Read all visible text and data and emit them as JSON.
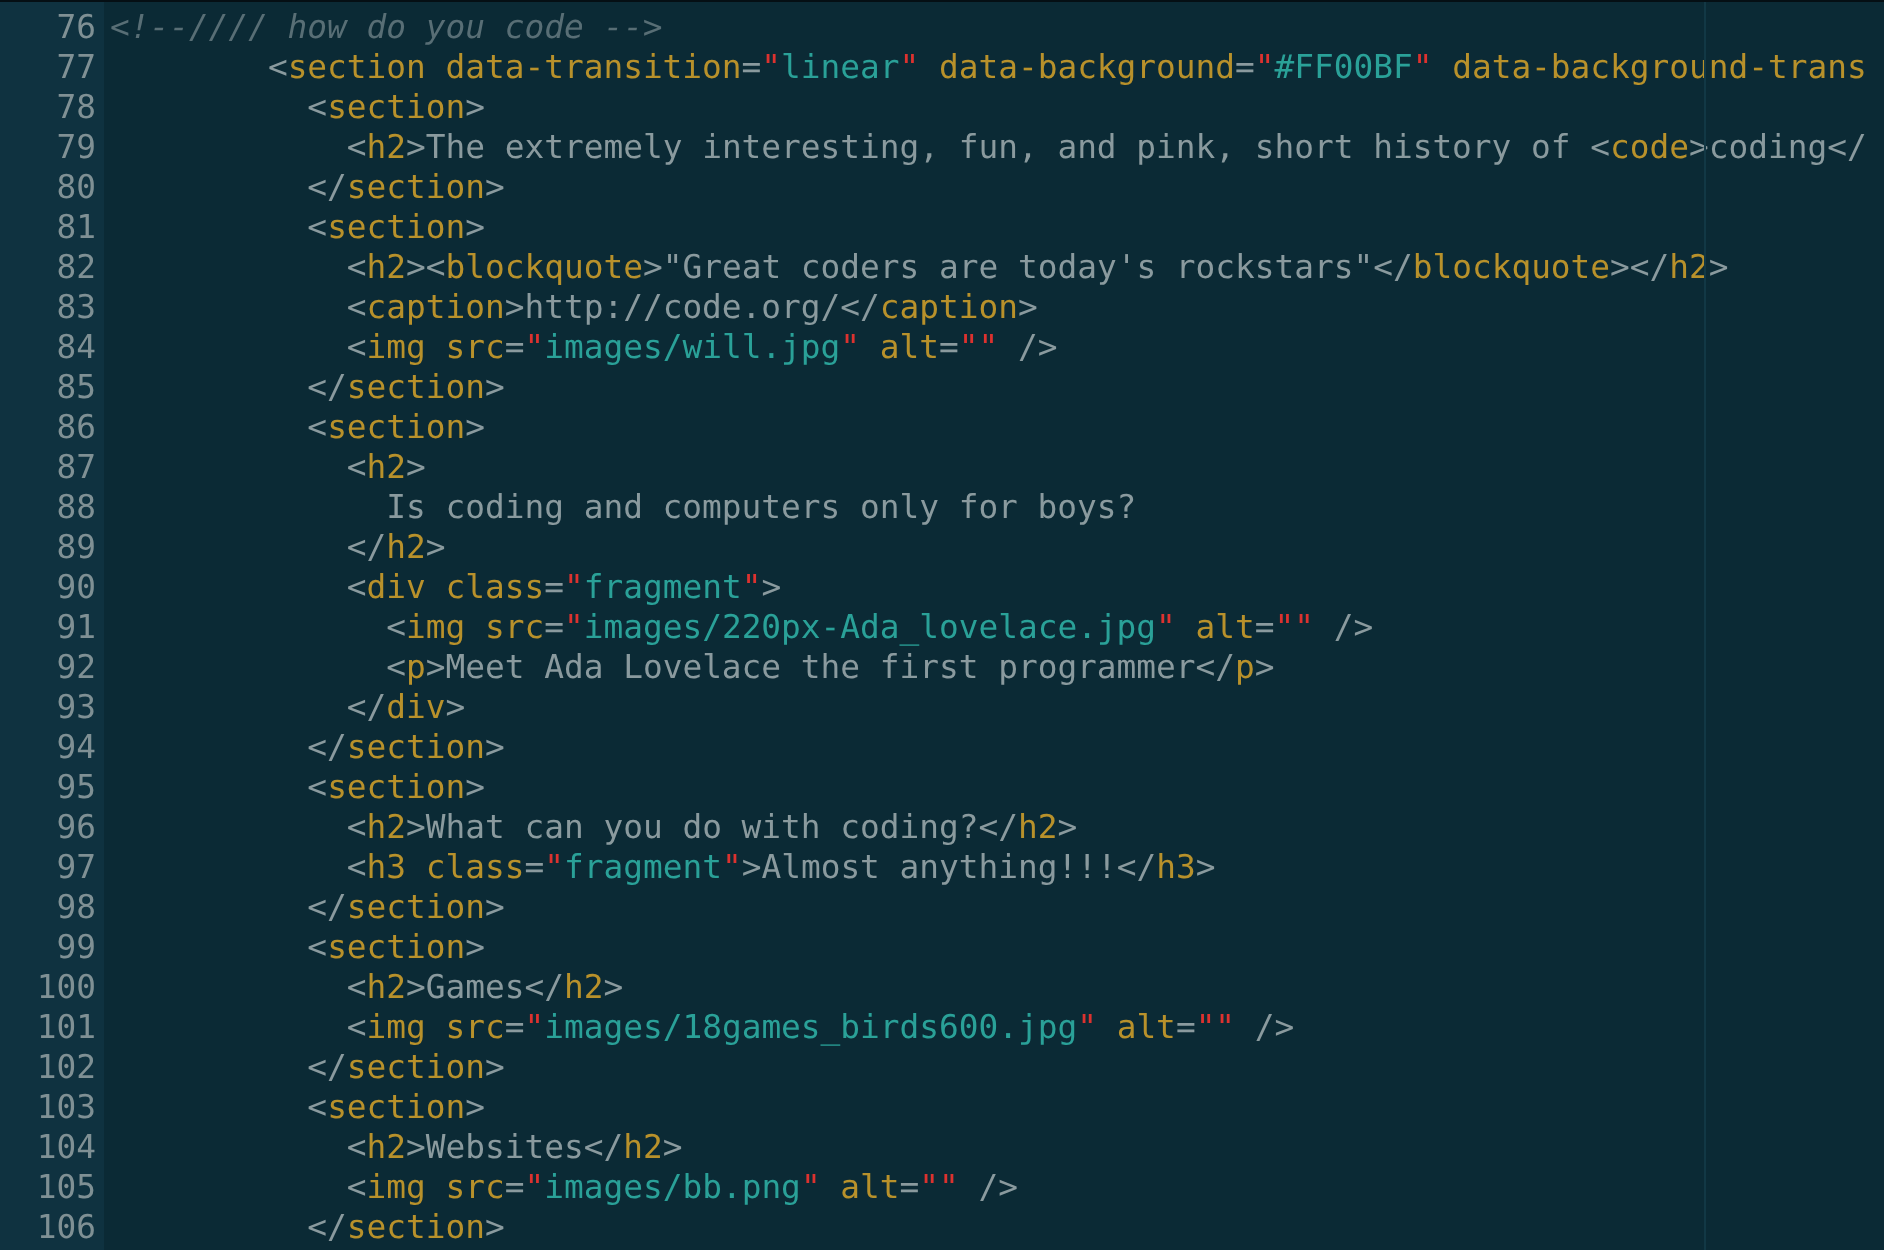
{
  "editor": {
    "lines": [
      {
        "number": "76",
        "tokens": [
          {
            "kind": "comment",
            "text": "<!--//// how do you code -->"
          }
        ]
      },
      {
        "number": "77",
        "tokens": [
          {
            "kind": "punct",
            "text": "        <"
          },
          {
            "kind": "tag",
            "text": "section"
          },
          {
            "kind": "attr",
            "text": " data-transition"
          },
          {
            "kind": "punct",
            "text": "="
          },
          {
            "kind": "quote",
            "text": "\""
          },
          {
            "kind": "string",
            "text": "linear"
          },
          {
            "kind": "quote",
            "text": "\""
          },
          {
            "kind": "attr",
            "text": " data-background"
          },
          {
            "kind": "punct",
            "text": "="
          },
          {
            "kind": "quote",
            "text": "\""
          },
          {
            "kind": "string",
            "text": "#FF00BF"
          },
          {
            "kind": "quote",
            "text": "\""
          },
          {
            "kind": "attr",
            "text": " data-background-trans"
          }
        ]
      },
      {
        "number": "78",
        "tokens": [
          {
            "kind": "punct",
            "text": "          <"
          },
          {
            "kind": "tag",
            "text": "section"
          },
          {
            "kind": "punct",
            "text": ">"
          }
        ]
      },
      {
        "number": "79",
        "tokens": [
          {
            "kind": "punct",
            "text": "            <"
          },
          {
            "kind": "tag",
            "text": "h2"
          },
          {
            "kind": "punct",
            "text": ">"
          },
          {
            "kind": "text",
            "text": "The extremely interesting, fun, and pink, short history of "
          },
          {
            "kind": "punct",
            "text": "<"
          },
          {
            "kind": "tag",
            "text": "code"
          },
          {
            "kind": "punct",
            "text": ">"
          },
          {
            "kind": "text",
            "text": "coding"
          },
          {
            "kind": "punct",
            "text": "</"
          }
        ]
      },
      {
        "number": "80",
        "tokens": [
          {
            "kind": "punct",
            "text": "          </"
          },
          {
            "kind": "tag",
            "text": "section"
          },
          {
            "kind": "punct",
            "text": ">"
          }
        ]
      },
      {
        "number": "81",
        "tokens": [
          {
            "kind": "punct",
            "text": "          <"
          },
          {
            "kind": "tag",
            "text": "section"
          },
          {
            "kind": "punct",
            "text": ">"
          }
        ]
      },
      {
        "number": "82",
        "tokens": [
          {
            "kind": "punct",
            "text": "            <"
          },
          {
            "kind": "tag",
            "text": "h2"
          },
          {
            "kind": "punct",
            "text": "><"
          },
          {
            "kind": "tag",
            "text": "blockquote"
          },
          {
            "kind": "punct",
            "text": ">"
          },
          {
            "kind": "text",
            "text": "\"Great coders are today's rockstars\""
          },
          {
            "kind": "punct",
            "text": "</"
          },
          {
            "kind": "tag",
            "text": "blockquote"
          },
          {
            "kind": "punct",
            "text": "></"
          },
          {
            "kind": "tag",
            "text": "h2"
          },
          {
            "kind": "punct",
            "text": ">"
          }
        ]
      },
      {
        "number": "83",
        "tokens": [
          {
            "kind": "punct",
            "text": "            <"
          },
          {
            "kind": "tag",
            "text": "caption"
          },
          {
            "kind": "punct",
            "text": ">"
          },
          {
            "kind": "text",
            "text": "http://code.org/"
          },
          {
            "kind": "punct",
            "text": "</"
          },
          {
            "kind": "tag",
            "text": "caption"
          },
          {
            "kind": "punct",
            "text": ">"
          }
        ]
      },
      {
        "number": "84",
        "tokens": [
          {
            "kind": "punct",
            "text": "            <"
          },
          {
            "kind": "tag",
            "text": "img"
          },
          {
            "kind": "attr",
            "text": " src"
          },
          {
            "kind": "punct",
            "text": "="
          },
          {
            "kind": "quote",
            "text": "\""
          },
          {
            "kind": "string",
            "text": "images/will.jpg"
          },
          {
            "kind": "quote",
            "text": "\""
          },
          {
            "kind": "attr",
            "text": " alt"
          },
          {
            "kind": "punct",
            "text": "="
          },
          {
            "kind": "quote",
            "text": "\"\""
          },
          {
            "kind": "punct",
            "text": " />"
          }
        ]
      },
      {
        "number": "85",
        "tokens": [
          {
            "kind": "punct",
            "text": "          </"
          },
          {
            "kind": "tag",
            "text": "section"
          },
          {
            "kind": "punct",
            "text": ">"
          }
        ]
      },
      {
        "number": "86",
        "tokens": [
          {
            "kind": "punct",
            "text": "          <"
          },
          {
            "kind": "tag",
            "text": "section"
          },
          {
            "kind": "punct",
            "text": ">"
          }
        ]
      },
      {
        "number": "87",
        "tokens": [
          {
            "kind": "punct",
            "text": "            <"
          },
          {
            "kind": "tag",
            "text": "h2"
          },
          {
            "kind": "punct",
            "text": ">"
          }
        ]
      },
      {
        "number": "88",
        "tokens": [
          {
            "kind": "text",
            "text": "              Is coding and computers only for boys?"
          }
        ]
      },
      {
        "number": "89",
        "tokens": [
          {
            "kind": "punct",
            "text": "            </"
          },
          {
            "kind": "tag",
            "text": "h2"
          },
          {
            "kind": "punct",
            "text": ">"
          }
        ]
      },
      {
        "number": "90",
        "tokens": [
          {
            "kind": "punct",
            "text": "            <"
          },
          {
            "kind": "tag",
            "text": "div"
          },
          {
            "kind": "attr",
            "text": " class"
          },
          {
            "kind": "punct",
            "text": "="
          },
          {
            "kind": "quote",
            "text": "\""
          },
          {
            "kind": "string",
            "text": "fragment"
          },
          {
            "kind": "quote",
            "text": "\""
          },
          {
            "kind": "punct",
            "text": ">"
          }
        ]
      },
      {
        "number": "91",
        "tokens": [
          {
            "kind": "punct",
            "text": "              <"
          },
          {
            "kind": "tag",
            "text": "img"
          },
          {
            "kind": "attr",
            "text": " src"
          },
          {
            "kind": "punct",
            "text": "="
          },
          {
            "kind": "quote",
            "text": "\""
          },
          {
            "kind": "string",
            "text": "images/220px-Ada_lovelace.jpg"
          },
          {
            "kind": "quote",
            "text": "\""
          },
          {
            "kind": "attr",
            "text": " alt"
          },
          {
            "kind": "punct",
            "text": "="
          },
          {
            "kind": "quote",
            "text": "\"\""
          },
          {
            "kind": "punct",
            "text": " />"
          }
        ]
      },
      {
        "number": "92",
        "tokens": [
          {
            "kind": "punct",
            "text": "              <"
          },
          {
            "kind": "tag",
            "text": "p"
          },
          {
            "kind": "punct",
            "text": ">"
          },
          {
            "kind": "text",
            "text": "Meet Ada Lovelace the first programmer"
          },
          {
            "kind": "punct",
            "text": "</"
          },
          {
            "kind": "tag",
            "text": "p"
          },
          {
            "kind": "punct",
            "text": ">"
          }
        ]
      },
      {
        "number": "93",
        "tokens": [
          {
            "kind": "punct",
            "text": "            </"
          },
          {
            "kind": "tag",
            "text": "div"
          },
          {
            "kind": "punct",
            "text": ">"
          }
        ]
      },
      {
        "number": "94",
        "tokens": [
          {
            "kind": "punct",
            "text": "          </"
          },
          {
            "kind": "tag",
            "text": "section"
          },
          {
            "kind": "punct",
            "text": ">"
          }
        ]
      },
      {
        "number": "95",
        "tokens": [
          {
            "kind": "punct",
            "text": "          <"
          },
          {
            "kind": "tag",
            "text": "section"
          },
          {
            "kind": "punct",
            "text": ">"
          }
        ]
      },
      {
        "number": "96",
        "tokens": [
          {
            "kind": "punct",
            "text": "            <"
          },
          {
            "kind": "tag",
            "text": "h2"
          },
          {
            "kind": "punct",
            "text": ">"
          },
          {
            "kind": "text",
            "text": "What can you do with coding?"
          },
          {
            "kind": "punct",
            "text": "</"
          },
          {
            "kind": "tag",
            "text": "h2"
          },
          {
            "kind": "punct",
            "text": ">"
          }
        ]
      },
      {
        "number": "97",
        "tokens": [
          {
            "kind": "punct",
            "text": "            <"
          },
          {
            "kind": "tag",
            "text": "h3"
          },
          {
            "kind": "attr",
            "text": " class"
          },
          {
            "kind": "punct",
            "text": "="
          },
          {
            "kind": "quote",
            "text": "\""
          },
          {
            "kind": "string",
            "text": "fragment"
          },
          {
            "kind": "quote",
            "text": "\""
          },
          {
            "kind": "punct",
            "text": ">"
          },
          {
            "kind": "text",
            "text": "Almost anything!!!"
          },
          {
            "kind": "punct",
            "text": "</"
          },
          {
            "kind": "tag",
            "text": "h3"
          },
          {
            "kind": "punct",
            "text": ">"
          }
        ]
      },
      {
        "number": "98",
        "tokens": [
          {
            "kind": "punct",
            "text": "          </"
          },
          {
            "kind": "tag",
            "text": "section"
          },
          {
            "kind": "punct",
            "text": ">"
          }
        ]
      },
      {
        "number": "99",
        "tokens": [
          {
            "kind": "punct",
            "text": "          <"
          },
          {
            "kind": "tag",
            "text": "section"
          },
          {
            "kind": "punct",
            "text": ">"
          }
        ]
      },
      {
        "number": "100",
        "tokens": [
          {
            "kind": "punct",
            "text": "            <"
          },
          {
            "kind": "tag",
            "text": "h2"
          },
          {
            "kind": "punct",
            "text": ">"
          },
          {
            "kind": "text",
            "text": "Games"
          },
          {
            "kind": "punct",
            "text": "</"
          },
          {
            "kind": "tag",
            "text": "h2"
          },
          {
            "kind": "punct",
            "text": ">"
          }
        ]
      },
      {
        "number": "101",
        "tokens": [
          {
            "kind": "punct",
            "text": "            <"
          },
          {
            "kind": "tag",
            "text": "img"
          },
          {
            "kind": "attr",
            "text": " src"
          },
          {
            "kind": "punct",
            "text": "="
          },
          {
            "kind": "quote",
            "text": "\""
          },
          {
            "kind": "string",
            "text": "images/18games_birds600.jpg"
          },
          {
            "kind": "quote",
            "text": "\""
          },
          {
            "kind": "attr",
            "text": " alt"
          },
          {
            "kind": "punct",
            "text": "="
          },
          {
            "kind": "quote",
            "text": "\"\""
          },
          {
            "kind": "punct",
            "text": " />"
          }
        ]
      },
      {
        "number": "102",
        "tokens": [
          {
            "kind": "punct",
            "text": "          </"
          },
          {
            "kind": "tag",
            "text": "section"
          },
          {
            "kind": "punct",
            "text": ">"
          }
        ]
      },
      {
        "number": "103",
        "tokens": [
          {
            "kind": "punct",
            "text": "          <"
          },
          {
            "kind": "tag",
            "text": "section"
          },
          {
            "kind": "punct",
            "text": ">"
          }
        ]
      },
      {
        "number": "104",
        "tokens": [
          {
            "kind": "punct",
            "text": "            <"
          },
          {
            "kind": "tag",
            "text": "h2"
          },
          {
            "kind": "punct",
            "text": ">"
          },
          {
            "kind": "text",
            "text": "Websites"
          },
          {
            "kind": "punct",
            "text": "</"
          },
          {
            "kind": "tag",
            "text": "h2"
          },
          {
            "kind": "punct",
            "text": ">"
          }
        ]
      },
      {
        "number": "105",
        "tokens": [
          {
            "kind": "punct",
            "text": "            <"
          },
          {
            "kind": "tag",
            "text": "img"
          },
          {
            "kind": "attr",
            "text": " src"
          },
          {
            "kind": "punct",
            "text": "="
          },
          {
            "kind": "quote",
            "text": "\""
          },
          {
            "kind": "string",
            "text": "images/bb.png"
          },
          {
            "kind": "quote",
            "text": "\""
          },
          {
            "kind": "attr",
            "text": " alt"
          },
          {
            "kind": "punct",
            "text": "="
          },
          {
            "kind": "quote",
            "text": "\"\""
          },
          {
            "kind": "punct",
            "text": " />"
          }
        ]
      },
      {
        "number": "106",
        "tokens": [
          {
            "kind": "punct",
            "text": "          </"
          },
          {
            "kind": "tag",
            "text": "section"
          },
          {
            "kind": "punct",
            "text": ">"
          }
        ]
      }
    ]
  }
}
